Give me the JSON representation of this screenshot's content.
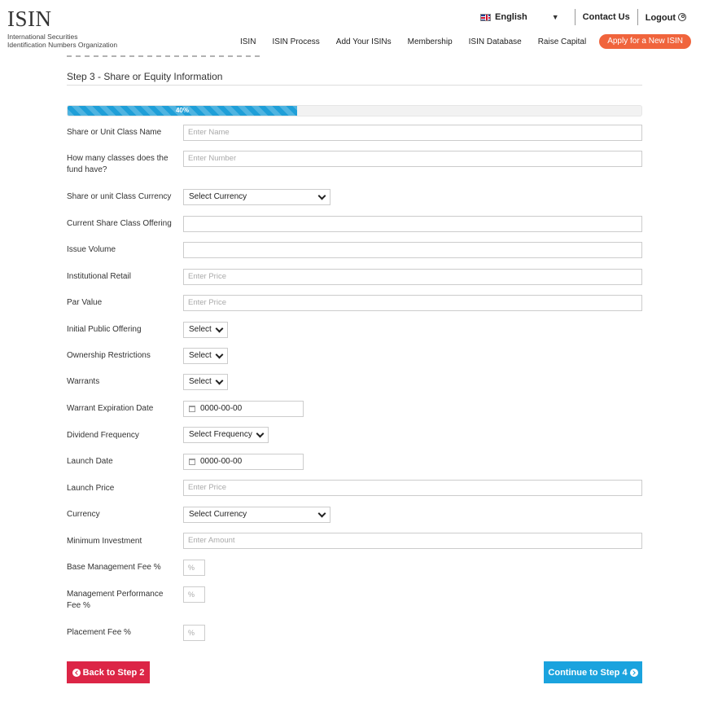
{
  "header": {
    "logo_main": "ISIN",
    "logo_sub_1": "International Securities",
    "logo_sub_2": "Identification Numbers Organization",
    "language": "English",
    "contact": "Contact Us",
    "logout": "Logout",
    "nav": [
      "ISIN",
      "ISIN Process",
      "Add Your ISINs",
      "Membership",
      "ISIN Database",
      "Raise Capital"
    ],
    "cta": "Apply for a New ISIN"
  },
  "step_title": "Step 3 - Share or Equity Information",
  "progress": {
    "label": "40%",
    "value": 0.4
  },
  "form": {
    "share_class_name": {
      "label": "Share or Unit Class Name",
      "placeholder": "Enter Name"
    },
    "num_classes": {
      "label": "How many classes does the fund have?",
      "placeholder": "Enter Number"
    },
    "class_currency": {
      "label": "Share or unit Class Currency",
      "value": "Select Currency"
    },
    "current_offering": {
      "label": "Current Share Class Offering",
      "placeholder": ""
    },
    "issue_volume": {
      "label": "Issue Volume",
      "placeholder": ""
    },
    "institutional_retail": {
      "label": "Institutional Retail",
      "placeholder": "Enter Price"
    },
    "par_value": {
      "label": "Par Value",
      "placeholder": "Enter Price"
    },
    "ipo": {
      "label": "Initial Public Offering",
      "value": "Select"
    },
    "ownership": {
      "label": "Ownership Restrictions",
      "value": "Select"
    },
    "warrants": {
      "label": "Warrants",
      "value": "Select"
    },
    "warrant_expiration": {
      "label": "Warrant Expiration Date",
      "value": "0000-00-00"
    },
    "dividend_frequency": {
      "label": "Dividend Frequency",
      "value": "Select Frequency"
    },
    "launch_date": {
      "label": "Launch Date",
      "value": "0000-00-00"
    },
    "launch_price": {
      "label": "Launch Price",
      "placeholder": "Enter Price"
    },
    "currency": {
      "label": "Currency",
      "value": "Select Currency"
    },
    "min_investment": {
      "label": "Minimum Investment",
      "placeholder": "Enter Amount"
    },
    "base_fee": {
      "label": "Base Management Fee %",
      "placeholder": "%"
    },
    "perf_fee": {
      "label": "Management Performance Fee %",
      "placeholder": "%"
    },
    "placement_fee": {
      "label": "Placement Fee %",
      "placeholder": "%"
    }
  },
  "buttons": {
    "back": "Back to Step 2",
    "next": "Continue to Step 4"
  }
}
